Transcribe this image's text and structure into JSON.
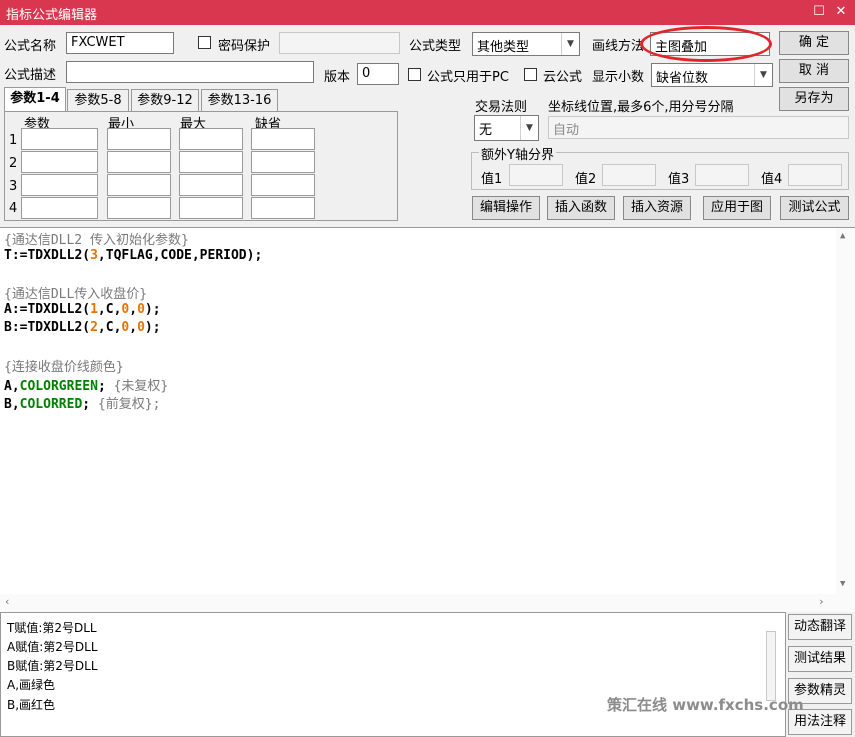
{
  "window": {
    "title": "指标公式编辑器",
    "restore_glyph": "☐",
    "close_glyph": "✕"
  },
  "form": {
    "name_label": "公式名称",
    "name_value": "FXCWET",
    "password_label": "密码保护",
    "password_value": "",
    "desc_label": "公式描述",
    "desc_value": "",
    "version_label": "版本",
    "version_value": "0",
    "pc_only_label": "公式只用于PC",
    "cloud_label": "云公式",
    "type_label": "公式类型",
    "type_value": "其他类型",
    "draw_label": "画线方法",
    "draw_value": "主图叠加",
    "decimals_label": "显示小数",
    "decimals_value": "缺省位数"
  },
  "buttons": {
    "ok": "确 定",
    "cancel": "取 消",
    "save_as": "另存为"
  },
  "tabs": [
    "参数1-4",
    "参数5-8",
    "参数9-12",
    "参数13-16"
  ],
  "param_table": {
    "headers": [
      "参数",
      "最小",
      "最大",
      "缺省"
    ],
    "rows": [
      "1",
      "2",
      "3",
      "4"
    ]
  },
  "trade": {
    "label": "交易法则",
    "value": "无"
  },
  "coord": {
    "label": "坐标线位置,最多6个,用分号分隔",
    "value": "自动"
  },
  "yaxis": {
    "title": "额外Y轴分界",
    "labels": [
      "值1",
      "值2",
      "值3",
      "值4"
    ]
  },
  "actions": [
    "编辑操作",
    "插入函数",
    "插入资源",
    "应用于图",
    "测试公式"
  ],
  "code": {
    "c1": "{通达信DLL2 传入初始化参数}",
    "l2a": "T:=TDXDLL2(",
    "l2b": "3",
    "l2c": ",TQFLAG,CODE,PERIOD);",
    "c3": "{通达信DLL传入收盘价}",
    "l4a": "A:=TDXDLL2(",
    "l4b": "1",
    "l4c": ",C,",
    "l4d": "0",
    "l4e": ",",
    "l4f": "0",
    "l4g": ");",
    "l5a": "B:=TDXDLL2(",
    "l5b": "2",
    "l5c": ",C,",
    "l5d": "0",
    "l5e": ",",
    "l5f": "0",
    "l5g": ");",
    "c6": "{连接收盘价线颜色}",
    "l7a": "A,",
    "l7b": "COLORGREEN",
    "l7c": ";",
    "l7d": " {未复权}",
    "l8a": "B,",
    "l8b": "COLORRED",
    "l8c": ";",
    "l8d": " {前复权};"
  },
  "output": [
    "T赋值:第2号DLL",
    "A赋值:第2号DLL",
    "B赋值:第2号DLL",
    "A,画绿色",
    " B,画红色"
  ],
  "side_buttons": [
    "动态翻译",
    "测试结果",
    "参数精灵",
    "用法注释"
  ],
  "watermark": "策汇在线 www.fxchs.com"
}
